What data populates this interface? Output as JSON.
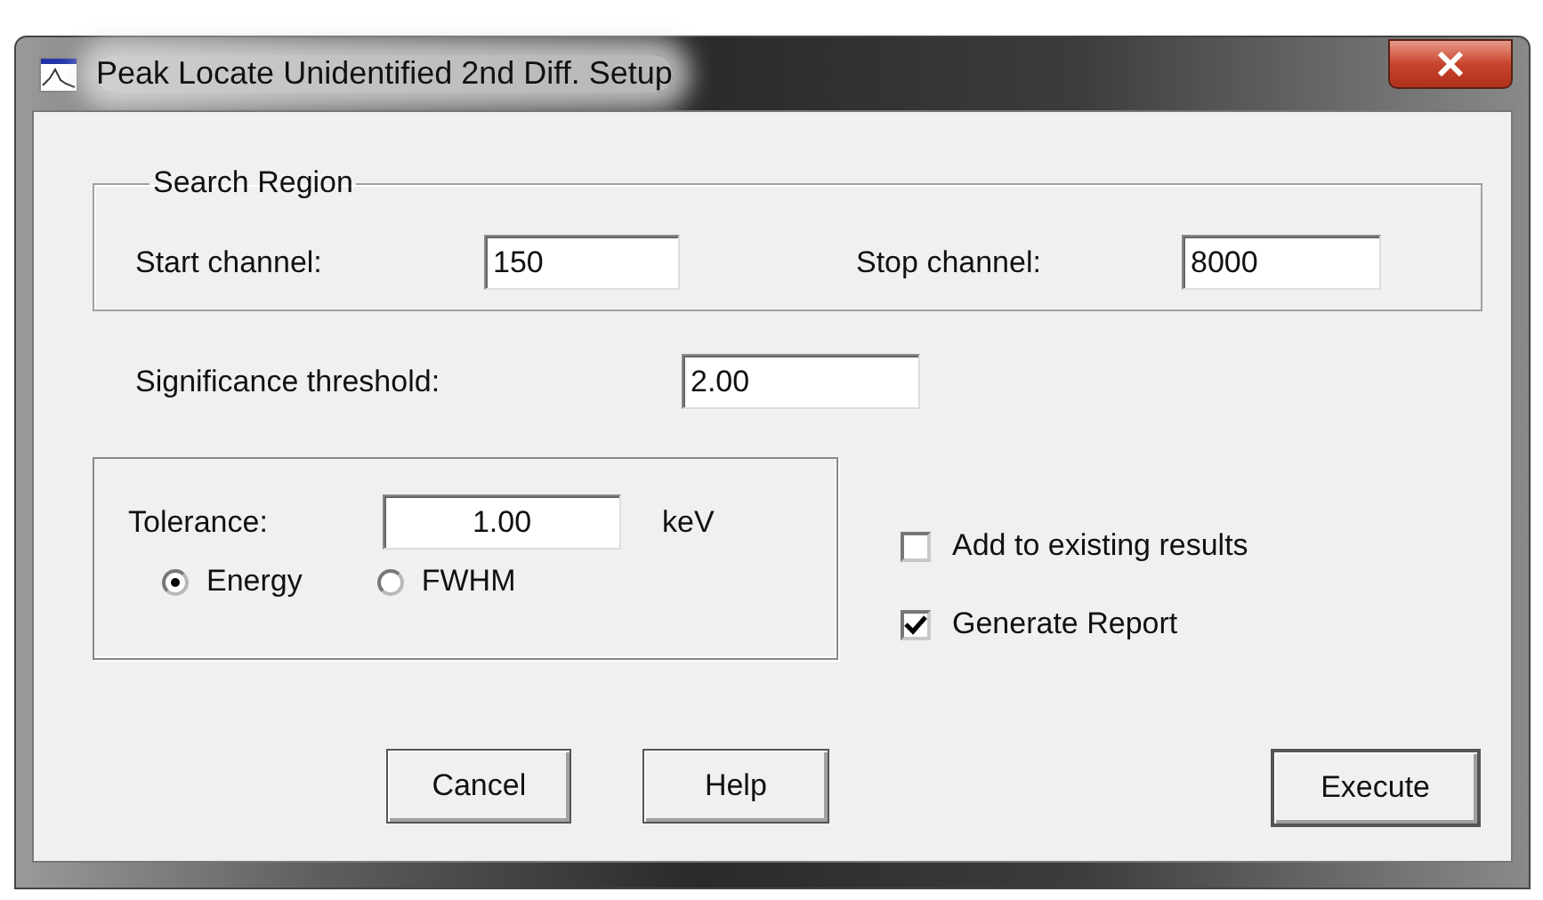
{
  "window": {
    "title": "Peak Locate Unidentified 2nd Diff. Setup"
  },
  "search_region": {
    "title": "Search Region",
    "fields": [
      {
        "label": "Start channel:",
        "value": "150"
      },
      {
        "label": "Stop channel:",
        "value": "8000"
      }
    ]
  },
  "significance": {
    "label": "Significance threshold:",
    "value": "2.00"
  },
  "tolerance": {
    "label": "Tolerance:",
    "value": "1.00",
    "unit": "keV",
    "options": [
      {
        "label": "Energy",
        "selected": true
      },
      {
        "label": "FWHM",
        "selected": false
      }
    ]
  },
  "checkboxes": [
    {
      "label": "Add to existing results",
      "checked": false
    },
    {
      "label": "Generate Report",
      "checked": true
    }
  ],
  "buttons": [
    {
      "label": "Cancel",
      "default": false
    },
    {
      "label": "Help",
      "default": false
    },
    {
      "label": "Execute",
      "default": true
    }
  ]
}
